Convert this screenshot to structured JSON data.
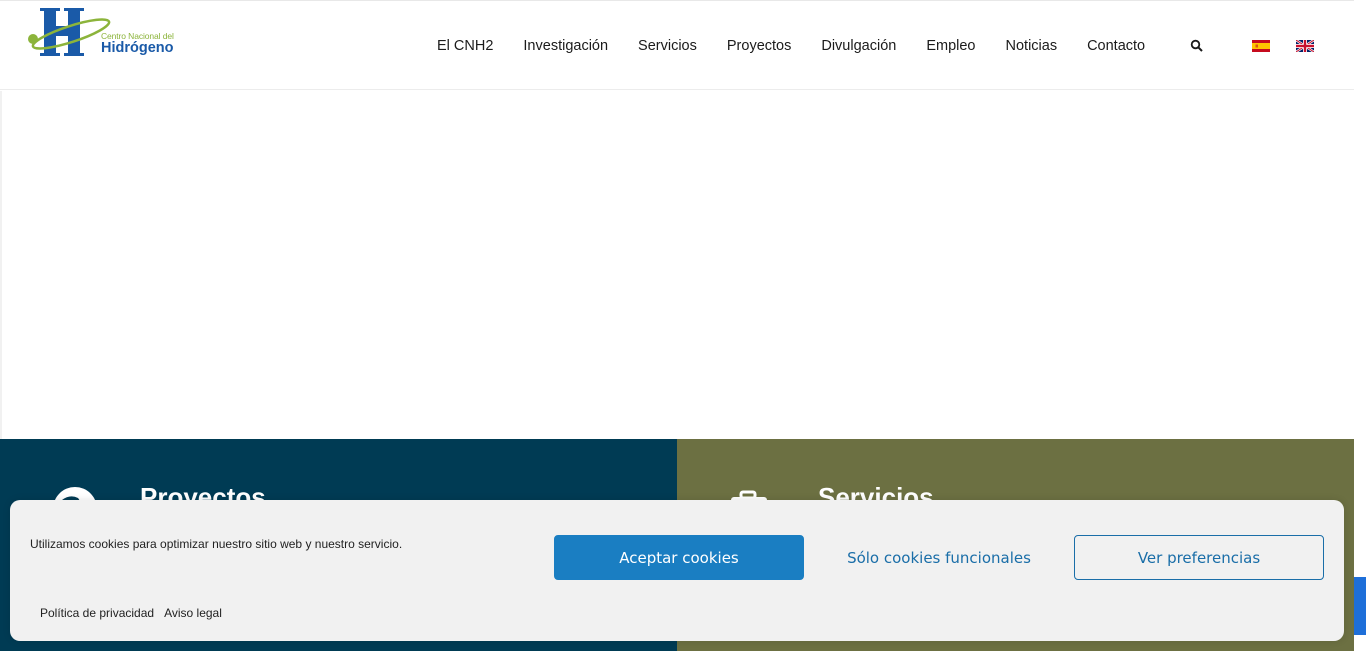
{
  "header": {
    "logo": {
      "subtitle": "Centro Nacional del",
      "name": "Hidrógeno",
      "colors": {
        "blue": "#1a5aa8",
        "green": "#8cb43b"
      }
    },
    "nav": [
      {
        "label": "El CNH2"
      },
      {
        "label": "Investigación"
      },
      {
        "label": "Servicios"
      },
      {
        "label": "Proyectos"
      },
      {
        "label": "Divulgación"
      },
      {
        "label": "Empleo"
      },
      {
        "label": "Noticias"
      },
      {
        "label": "Contacto"
      }
    ],
    "search_icon": "search-icon",
    "flags": [
      "flag-es-icon",
      "flag-en-icon"
    ]
  },
  "panels": {
    "left": {
      "title": "Proyectos",
      "icon": "globe-icon",
      "color": "#003b54"
    },
    "right": {
      "title": "Servicios",
      "icon": "briefcase-icon",
      "color": "#6c7042"
    }
  },
  "cookie": {
    "message": "Utilizamos cookies para optimizar nuestro sitio web y nuestro servicio.",
    "accept_label": "Aceptar cookies",
    "functional_label": "Sólo cookies funcionales",
    "preferences_label": "Ver preferencias",
    "links": [
      {
        "label": "Política de privacidad"
      },
      {
        "label": "Aviso legal"
      }
    ],
    "accent": "#1a7ec2"
  }
}
